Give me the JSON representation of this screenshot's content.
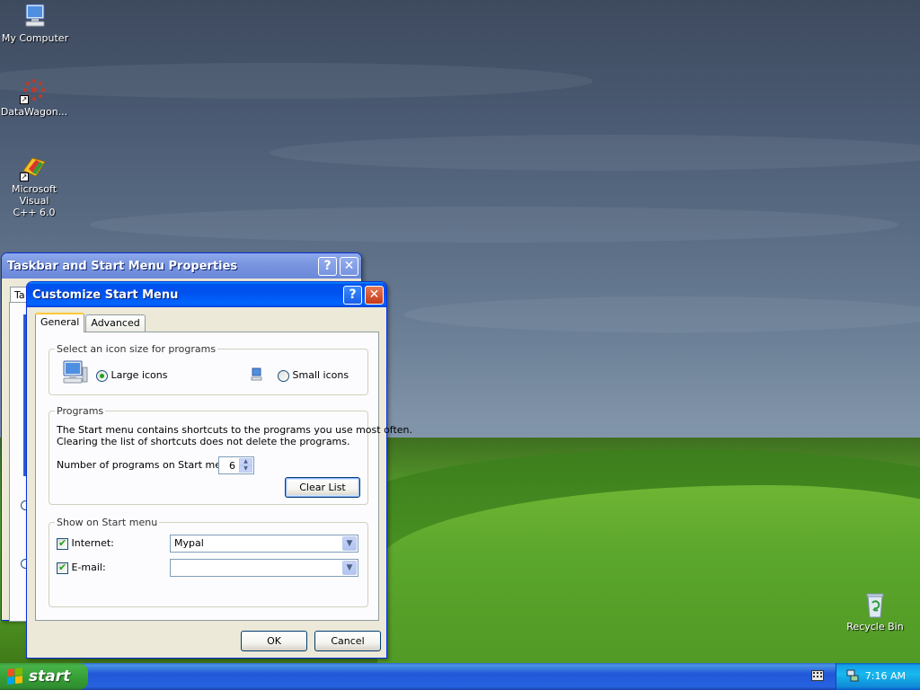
{
  "desktop": {
    "icons": [
      {
        "label": "My Computer",
        "icon": "computer-icon"
      },
      {
        "label": "DataWagon...",
        "icon": "datawagon-icon"
      },
      {
        "label_line1": "Microsoft Visual",
        "label_line2": "C++ 6.0",
        "icon": "visual-cpp-icon"
      },
      {
        "label": "Recycle Bin",
        "icon": "recycle-bin-icon"
      }
    ]
  },
  "back_window": {
    "title": "Taskbar and Start Menu Properties",
    "tab_stub": "Ta",
    "help_glyph": "?",
    "close_glyph": "✕"
  },
  "dialog": {
    "title": "Customize Start Menu",
    "help_glyph": "?",
    "close_glyph": "✕",
    "tabs": [
      {
        "label": "General",
        "active": true
      },
      {
        "label": "Advanced",
        "active": false
      }
    ],
    "icon_size_group": {
      "legend": "Select an icon size for programs",
      "large_label": "Large icons",
      "small_label": "Small icons",
      "selected": "large"
    },
    "programs_group": {
      "legend": "Programs",
      "description_line1": "The Start menu contains shortcuts to the programs you use most often.",
      "description_line2": "Clearing the list of shortcuts does not delete the programs.",
      "count_label": "Number of programs on Start menu:",
      "count_value": "6",
      "clear_button": "Clear List"
    },
    "show_group": {
      "legend": "Show on Start menu",
      "internet_label": "Internet:",
      "internet_checked": true,
      "internet_value": "Mypal",
      "email_label": "E-mail:",
      "email_checked": true,
      "email_value": ""
    },
    "ok_button": "OK",
    "cancel_button": "Cancel"
  },
  "taskbar": {
    "start_label": "start",
    "clock": "7:16 AM"
  },
  "colors": {
    "titlebar_active": "#0053ee",
    "start_green": "#37a137",
    "tray_blue": "#18b9ed"
  }
}
